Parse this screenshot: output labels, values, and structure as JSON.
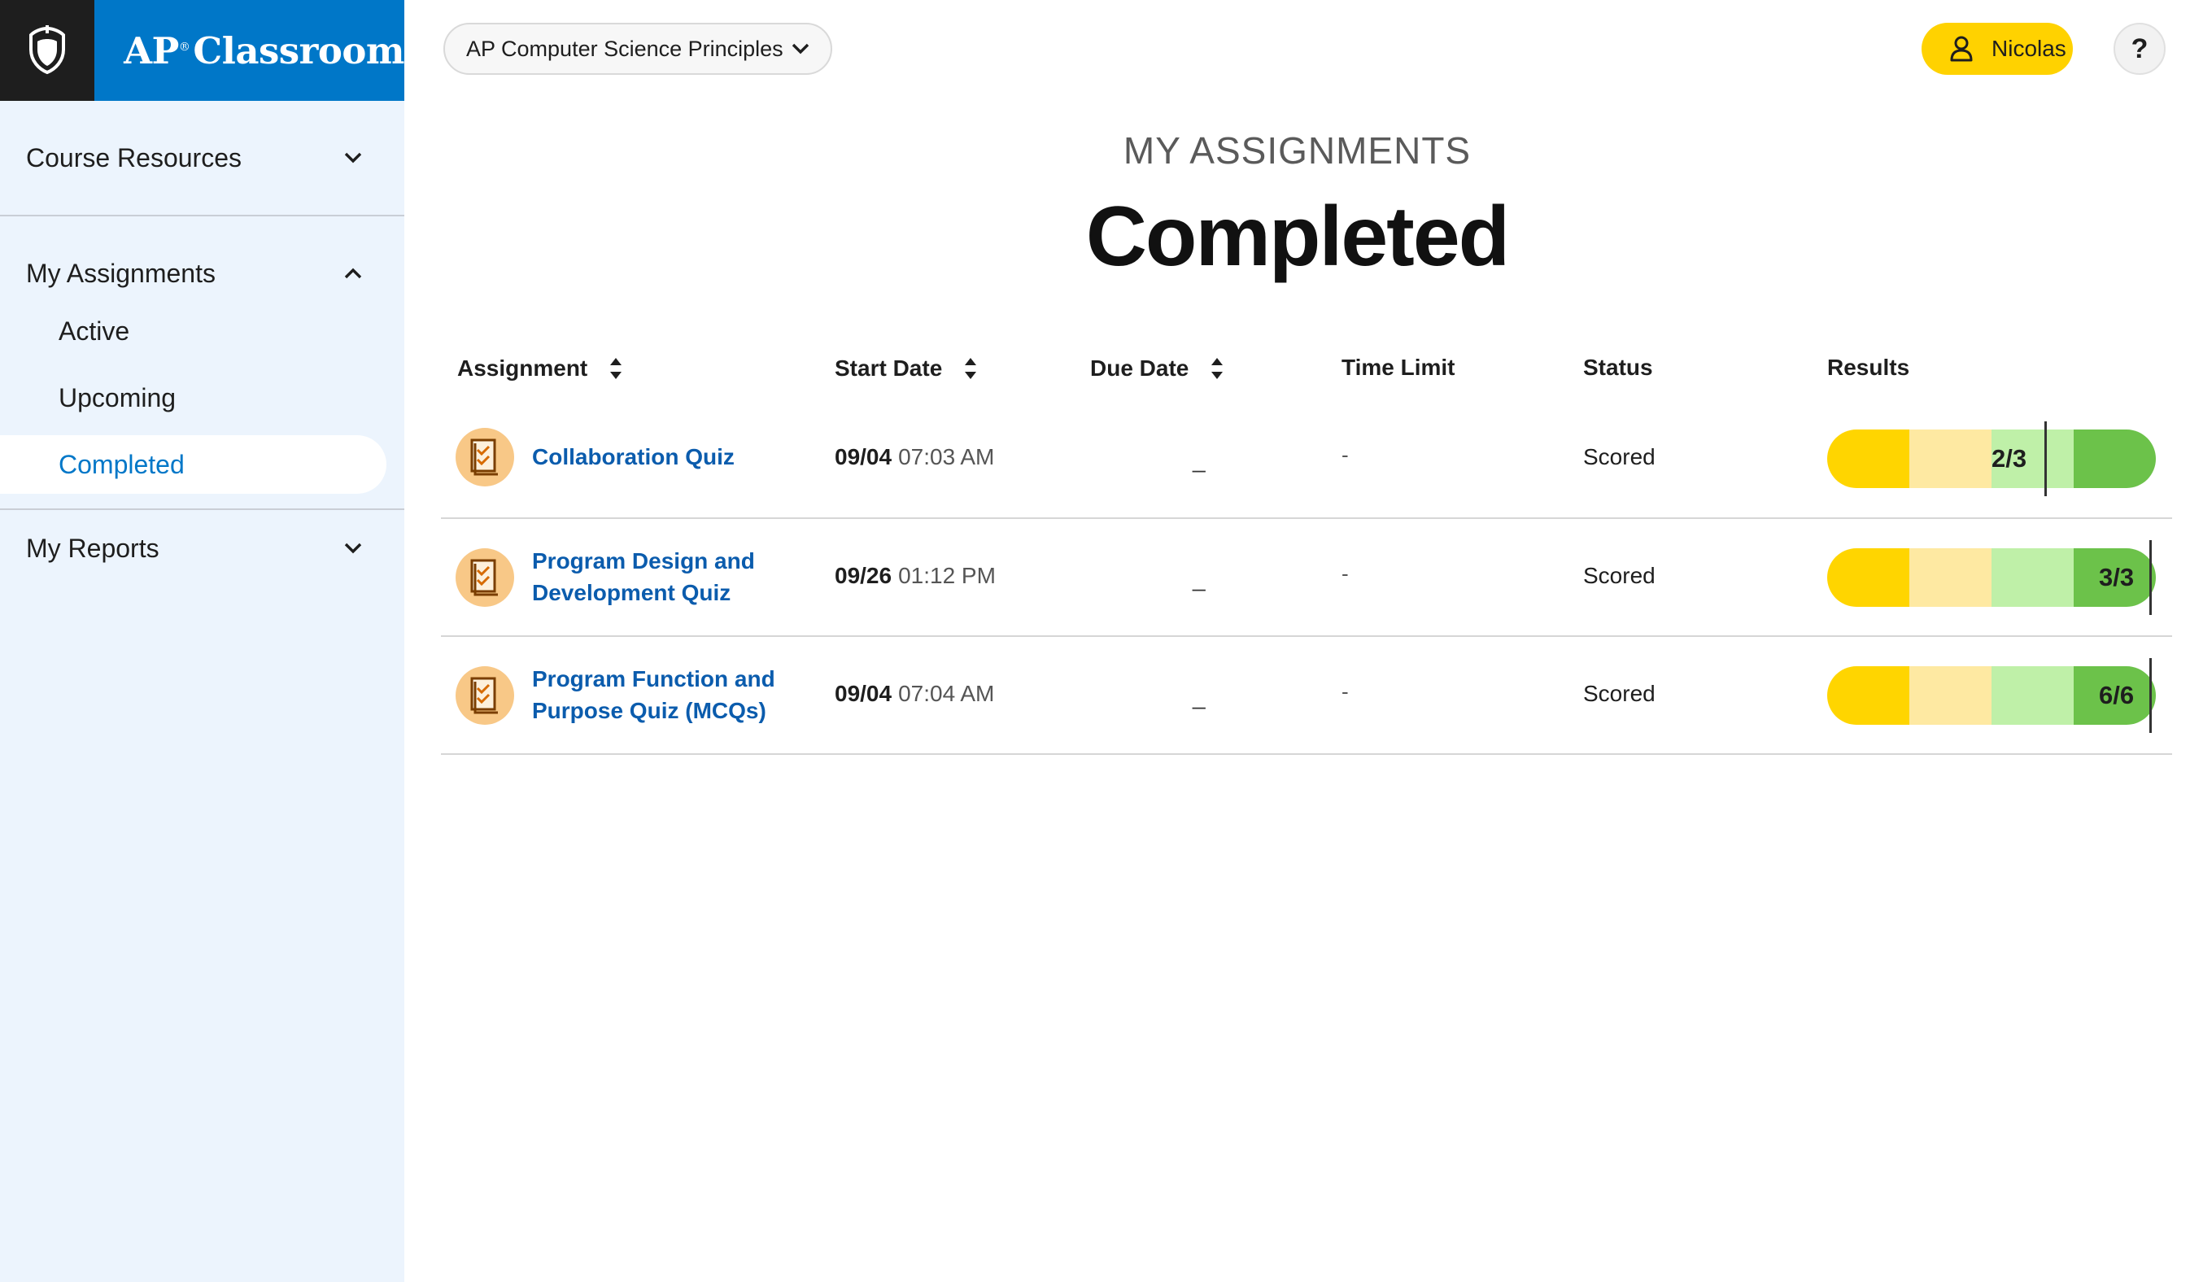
{
  "brand": {
    "name": "AP",
    "reg": "®",
    "product": "Classroom",
    "icon": "acorn-shield-icon"
  },
  "sidebar": {
    "sections": [
      {
        "label": "Course Resources",
        "expanded": false
      },
      {
        "label": "My Assignments",
        "expanded": true,
        "items": [
          {
            "label": "Active"
          },
          {
            "label": "Upcoming"
          },
          {
            "label": "Completed",
            "active": true
          }
        ]
      },
      {
        "label": "My Reports",
        "expanded": false
      }
    ]
  },
  "topbar": {
    "course": "AP Computer Science Principles",
    "user": "Nicolas",
    "help": "?"
  },
  "page": {
    "kicker": "MY ASSIGNMENTS",
    "title": "Completed"
  },
  "table": {
    "headers": {
      "assignment": "Assignment",
      "start_date": "Start Date",
      "due_date": "Due Date",
      "time_limit": "Time Limit",
      "status": "Status",
      "results": "Results"
    },
    "rows": [
      {
        "name_line1": "Collaboration Quiz",
        "name_line2": "",
        "start_day": "09/04",
        "start_time": "07:03 AM",
        "due": "_",
        "time_limit": "-",
        "status": "Scored",
        "result": "2/3",
        "score_fraction": 0.667
      },
      {
        "name_line1": "Program Design and",
        "name_line2": "Development Quiz",
        "start_day": "09/26",
        "start_time": "01:12 PM",
        "due": "_",
        "time_limit": "-",
        "status": "Scored",
        "result": "3/3",
        "score_fraction": 1.0
      },
      {
        "name_line1": "Program Function and",
        "name_line2": "Purpose Quiz (MCQs)",
        "start_day": "09/04",
        "start_time": "07:04 AM",
        "due": "_",
        "time_limit": "-",
        "status": "Scored",
        "result": "6/6",
        "score_fraction": 1.0
      }
    ]
  },
  "colors": {
    "brand_blue": "#0077c8",
    "sidebar_bg": "#ecf4fd",
    "user_yellow": "#ffd200",
    "link_blue": "#0b5cad",
    "result_yellow": "#ffd500",
    "result_light_yellow": "#fee9a2",
    "result_light_green": "#bff0a8",
    "result_green": "#6cc24a"
  }
}
